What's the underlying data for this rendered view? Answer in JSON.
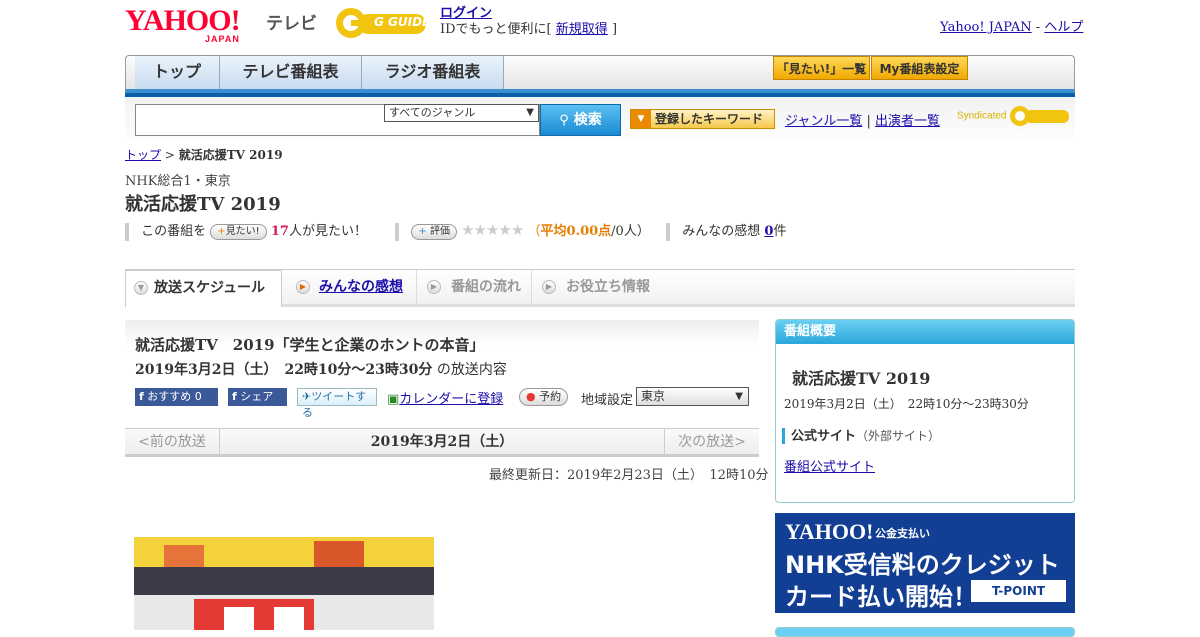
{
  "header": {
    "yahoo_logo": "YAHOO!",
    "yahoo_logo_sub": "JAPAN",
    "service_name": "テレビ",
    "gguide_logo": "G GUIDE",
    "login_label": "ログイン",
    "id_prompt_prefix": "IDでもっと便利に[",
    "register_label": "新規取得",
    "id_prompt_suffix": "]",
    "yahoo_japan_link": "Yahoo! JAPAN",
    "separator": "-",
    "help_link": "ヘルプ"
  },
  "nav": {
    "tabs": [
      {
        "label": "トップ"
      },
      {
        "label": "テレビ番組表"
      },
      {
        "label": "ラジオ番組表"
      }
    ],
    "watchlist_button": "「見たい!」一覧",
    "mylist_button": "My番組表設定"
  },
  "search": {
    "genre_selected": "すべてのジャンル",
    "search_button": "検索",
    "keyword_button": "登録したキーワード",
    "genre_list_link": "ジャンル一覧",
    "divider": "|",
    "performer_list_link": "出演者一覧",
    "syndicated_label": "Syndicated"
  },
  "breadcrumb": {
    "home": "トップ",
    "separator": ">",
    "current": "就活応援TV 2019"
  },
  "program": {
    "channel": "NHK総合1・東京",
    "title": "就活応援TV 2019",
    "stats": {
      "prefix": "この番組を",
      "want_button": "見たい!",
      "want_count": "17",
      "want_suffix": "人が見たい！",
      "rate_button": "評価",
      "stars": "★★★★★",
      "avg_open": "（",
      "avg_label": "平均0.00点",
      "avg_count": "/0人）",
      "impressions_label": "みんなの感想",
      "impressions_count": "0",
      "impressions_suffix": "件"
    }
  },
  "tabs": [
    {
      "label": "放送スケジュール"
    },
    {
      "label": "みんなの感想"
    },
    {
      "label": "番組の流れ"
    },
    {
      "label": "お役立ち情報"
    }
  ],
  "episode": {
    "title": "就活応援TV　2019「学生と企業のホントの本音」",
    "air_time": "2019年3月2日（土）　22時10分～23時30分",
    "air_time_suffix": "の放送内容",
    "fb_recommend": "おすすめ 0",
    "fb_share": "シェア",
    "tweet": "ツイートする",
    "calendar": "カレンダーに登録",
    "reserve": "予約",
    "region_label": "地域設定",
    "region_selected": "東京",
    "prev": "<前の放送",
    "date": "2019年3月2日（土）",
    "next": "次の放送>",
    "last_updated": "最終更新日：2019年2月23日（土）　12時10分"
  },
  "overview": {
    "heading": "番組概要",
    "title": "就活応援TV 2019",
    "time": "2019年3月2日（土）　22時10分～23時30分",
    "official_label": "公式サイト",
    "official_note": "（外部サイト）",
    "official_link": "番組公式サイト"
  },
  "banner": {
    "logo": "YAHOO!",
    "service": "公金支払い",
    "line1": "NHK受信料のクレジット",
    "line2": "カード払い開始！",
    "tpoint": "T-POINT"
  },
  "colors": {
    "nav_blue": "#3a8fd1",
    "yahoo_red": "#ff0033",
    "overview_head": "#2ba6dc",
    "banner_bg": "#123e93"
  }
}
